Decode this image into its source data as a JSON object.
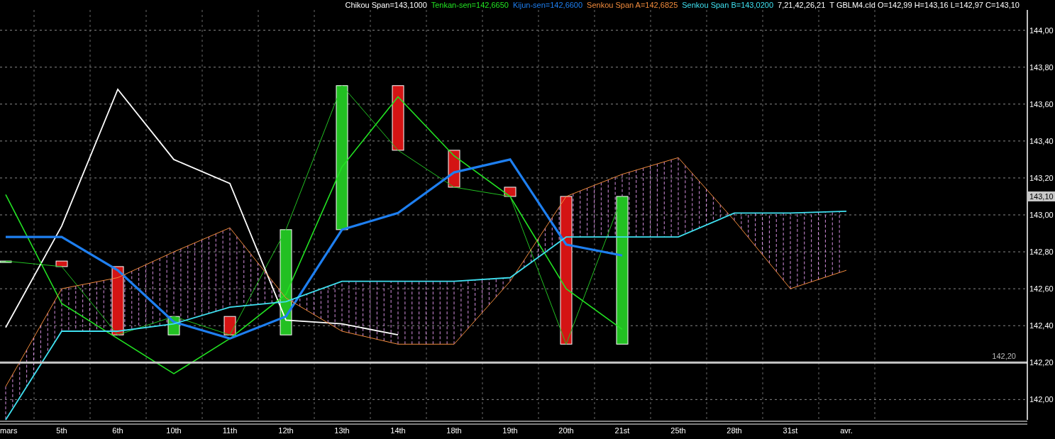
{
  "header": [
    {
      "text": "Chikou Span=143,1000",
      "color": "#ffffff"
    },
    {
      "text": "Tenkan-sen=142,6650",
      "color": "#22e322"
    },
    {
      "text": "Kijun-sen=142,6600",
      "color": "#1e7ff0"
    },
    {
      "text": "Senkou Span A=142,6825",
      "color": "#f08a3c"
    },
    {
      "text": "Senkou Span B=143,0200",
      "color": "#3fe0f0"
    },
    {
      "text": "7,21,42,26,21",
      "color": "#ffffff"
    },
    {
      "text": "T GBLM4.cId O=142,99 H=143,16 L=142,97 C=143,10",
      "color": "#ffffff"
    }
  ],
  "chart_data": {
    "type": "line",
    "categories": [
      "mars",
      "5th",
      "6th",
      "10th",
      "11th",
      "12th",
      "13th",
      "14th",
      "18th",
      "19th",
      "20th",
      "21st",
      "25th",
      "28th",
      "31st",
      "avr."
    ],
    "ylim": [
      141.89,
      144.11
    ],
    "yticks": [
      {
        "value": 142.0,
        "label": "142,00"
      },
      {
        "value": 142.2,
        "label": "142,20"
      },
      {
        "value": 142.4,
        "label": "142,40"
      },
      {
        "value": 142.6,
        "label": "142,60"
      },
      {
        "value": 142.8,
        "label": "142,80"
      },
      {
        "value": 143.0,
        "label": "143,00"
      },
      {
        "value": 143.2,
        "label": "143,20"
      },
      {
        "value": 143.4,
        "label": "143,40"
      },
      {
        "value": 143.6,
        "label": "143,60"
      },
      {
        "value": 143.8,
        "label": "143,80"
      },
      {
        "value": 144.0,
        "label": "144,00"
      }
    ],
    "series": [
      {
        "color": "#22c022",
        "values": [
          142.75,
          142.72,
          142.35,
          142.45,
          142.35,
          142.92,
          143.7,
          143.35,
          143.15,
          143.1,
          142.3,
          143.1,
          null,
          null,
          null,
          null
        ]
      },
      {
        "color": "#ffffff",
        "values": [
          142.39,
          142.94,
          143.68,
          143.3,
          143.17,
          142.43,
          142.41,
          142.35,
          null,
          null,
          null,
          null,
          null,
          null,
          null,
          null
        ]
      },
      {
        "color": "#22e322",
        "values": [
          143.11,
          142.52,
          142.33,
          142.14,
          142.33,
          142.57,
          143.26,
          143.64,
          143.32,
          143.1,
          142.6,
          142.38,
          null,
          null,
          null,
          null
        ]
      },
      {
        "color": "#1e7ff0",
        "values": [
          142.88,
          142.88,
          142.7,
          142.42,
          142.33,
          142.45,
          142.92,
          143.01,
          143.23,
          143.3,
          142.84,
          142.78,
          null,
          null,
          null,
          null
        ]
      },
      {
        "color": "#f08a3c",
        "values": [
          142.07,
          142.6,
          142.66,
          142.8,
          142.93,
          142.55,
          142.37,
          142.3,
          142.3,
          142.64,
          143.1,
          143.22,
          143.31,
          142.97,
          142.6,
          142.7
        ]
      },
      {
        "color": "#3fe0f0",
        "values": [
          141.89,
          142.37,
          142.37,
          142.41,
          142.5,
          142.53,
          142.64,
          142.64,
          142.64,
          142.66,
          142.88,
          142.88,
          142.88,
          143.01,
          143.01,
          143.02
        ]
      }
    ],
    "grid": true,
    "ref_lines": [
      {
        "axis": "y",
        "value": 142.2,
        "label": "142,20"
      }
    ]
  },
  "last_price_tag": "143,10"
}
